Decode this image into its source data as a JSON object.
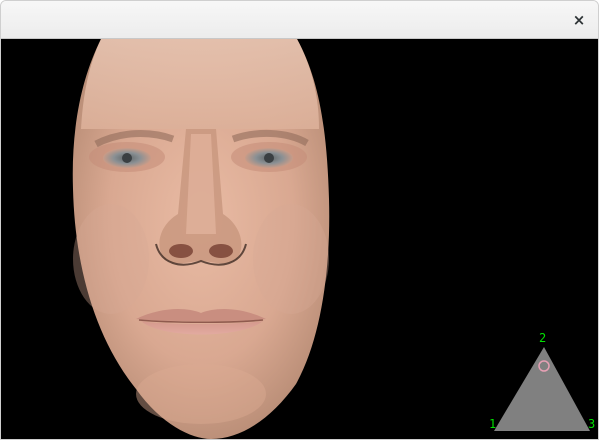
{
  "window": {
    "close_glyph": "×",
    "close_icon": "close-icon"
  },
  "viewport": {
    "background": "#000000",
    "content": "3D face render"
  },
  "triangle_widget": {
    "fill": "#808080",
    "label_color": "#00e000",
    "marker_color": "#e6a0b4",
    "vertex_labels": [
      "1",
      "2",
      "3"
    ]
  }
}
